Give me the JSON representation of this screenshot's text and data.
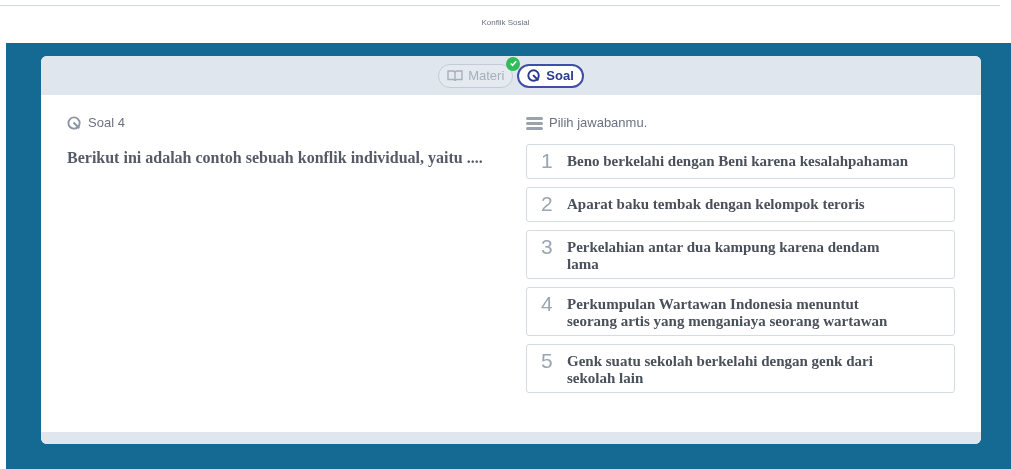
{
  "page_title": "Konflik Sosial",
  "tabs": [
    {
      "label": "Materi",
      "kind": "book",
      "selected": false,
      "done": true
    },
    {
      "label": "Soal",
      "kind": "quiz",
      "selected": true,
      "done": false
    }
  ],
  "question": {
    "label": "Soal 4",
    "text": "Berikut ini adalah contoh sebuah konflik individual, yaitu ...."
  },
  "answers_header": "Pilih jawabanmu.",
  "options": [
    {
      "number": "1",
      "text": "Beno berkelahi dengan Beni karena kesalahpahaman"
    },
    {
      "number": "2",
      "text": "Aparat baku tembak dengan kelompok teroris"
    },
    {
      "number": "3",
      "text": "Perkelahian antar dua kampung karena dendam lama"
    },
    {
      "number": "4",
      "text": "Perkumpulan Wartawan Indonesia menuntut seorang artis yang menganiaya seorang wartawan"
    },
    {
      "number": "5",
      "text": "Genk suatu sekolah berkelahi dengan genk dari sekolah lain"
    }
  ]
}
